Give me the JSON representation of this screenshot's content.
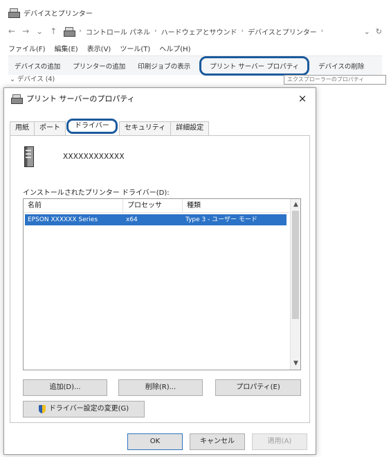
{
  "explorer": {
    "title": "デバイスとプリンター",
    "crumbs": [
      "コントロール パネル",
      "ハードウェアとサウンド",
      "デバイスとプリンター"
    ],
    "menu": [
      "ファイル(F)",
      "編集(E)",
      "表示(V)",
      "ツール(T)",
      "ヘルプ(H)"
    ],
    "commands": {
      "add_device": "デバイスの追加",
      "add_printer": "プリンターの追加",
      "see_print_jobs": "印刷ジョブの表示",
      "print_server_properties": "プリント サーバー プロパティ",
      "remove_device": "デバイスの削除"
    },
    "group_header": "デバイス (4)",
    "side_field": "エクスプローラーのプロパティ"
  },
  "dialog": {
    "title": "プリント サーバーのプロパティ",
    "close_glyph": "×",
    "tabs": {
      "forms": "用紙",
      "ports": "ポート",
      "drivers": "ドライバー",
      "security": "セキュリティ",
      "advanced": "詳細設定"
    },
    "server_name": "XXXXXXXXXXXX",
    "list_label": "インストールされたプリンター ドライバー(D):",
    "columns": {
      "name": "名前",
      "processor": "プロセッサ",
      "type": "種類"
    },
    "rows": [
      {
        "name": "EPSON XXXXXX Series",
        "processor": "x64",
        "type": "Type 3 - ユーザー モード"
      }
    ],
    "buttons": {
      "add": "追加(D)...",
      "remove": "削除(R)...",
      "properties": "プロパティ(E)",
      "change_settings": "ドライバー設定の変更(G)",
      "ok": "OK",
      "cancel": "キャンセル",
      "apply": "適用(A)"
    }
  },
  "colors": {
    "highlight_ring": "#1c5a9c",
    "selection": "#2b73c6"
  }
}
